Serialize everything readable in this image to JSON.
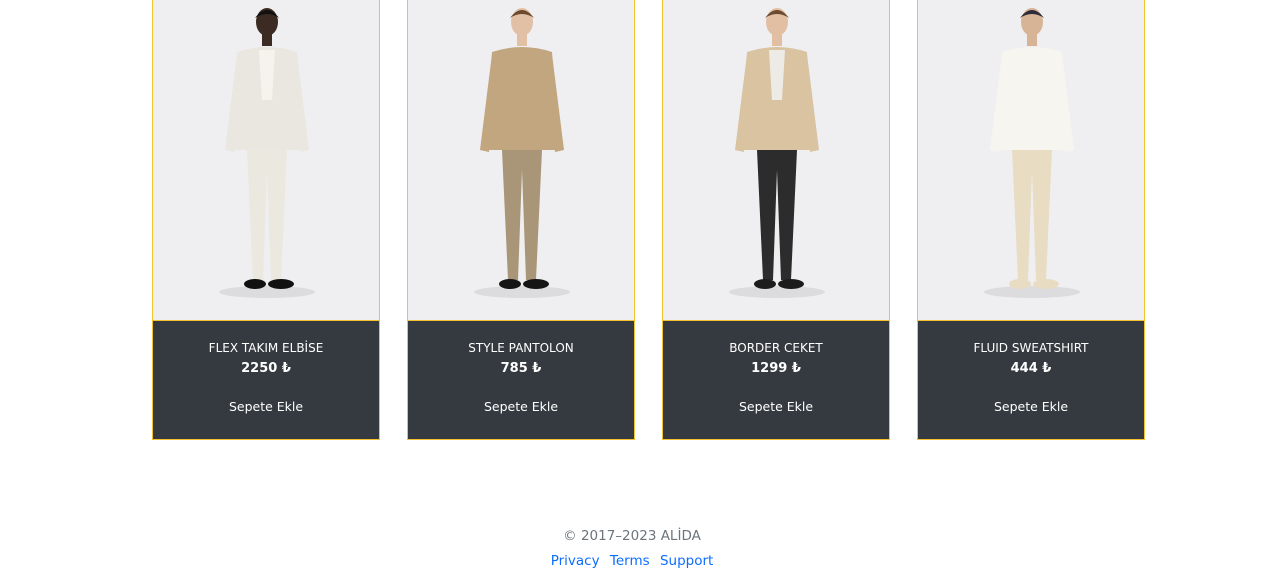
{
  "products": [
    {
      "name": "FLEX TAKIM ELBİSE",
      "price": "2250 ₺",
      "cta": "Sepete Ekle",
      "outfit": {
        "top": "#e9e7e0",
        "bottom": "#ebe8e0",
        "skin": "#3c2b22",
        "hair": "#111111",
        "shoes": "#111111",
        "inner": "#f4f3ee",
        "bag": "#c9bfa6"
      }
    },
    {
      "name": "STYLE PANTOLON",
      "price": "785 ₺",
      "cta": "Sepete Ekle",
      "outfit": {
        "top": "#c2a67f",
        "bottom": "#a99678",
        "skin": "#e2c0a6",
        "hair": "#6b4a2e",
        "shoes": "#151515",
        "inner": "#c2a67f",
        "bag": "#8a7556"
      }
    },
    {
      "name": "BORDER CEKET",
      "price": "1299 ₺",
      "cta": "Sepete Ekle",
      "outfit": {
        "top": "#d9c3a0",
        "bottom": "#2c2c2c",
        "skin": "#e2bfa3",
        "hair": "#6a4a31",
        "shoes": "#1c1c1c",
        "inner": "#ecebe6",
        "bag": "#d9c3a0"
      }
    },
    {
      "name": "FLUID SWEATSHIRT",
      "price": "444 ₺",
      "cta": "Sepete Ekle",
      "outfit": {
        "top": "#f6f5f0",
        "bottom": "#e8dcc3",
        "skin": "#d8b497",
        "hair": "#2e2b3a",
        "shoes": "#e8dcc3",
        "inner": "#f6f5f0",
        "bag": "#f6f5f0"
      }
    }
  ],
  "footer": {
    "copyright": "© 2017–2023 ALİDA",
    "links": [
      "Privacy",
      "Terms",
      "Support"
    ]
  }
}
